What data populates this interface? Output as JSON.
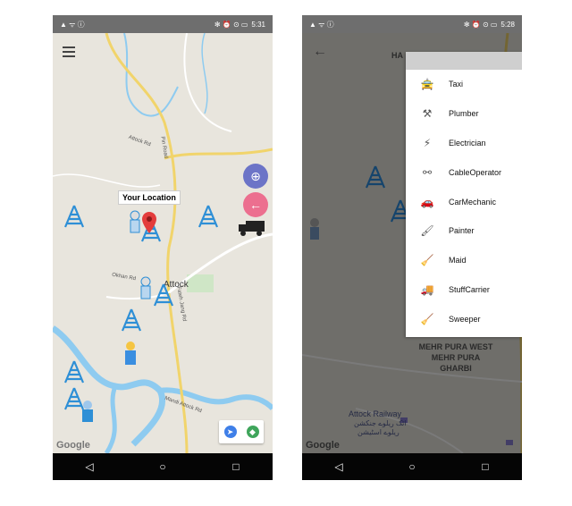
{
  "left_screen": {
    "status": {
      "left_icons": "▲ ᯤ ⓘ",
      "right_icons": "✻ ⏰ ⊙ ▭",
      "time": "5:31"
    },
    "your_location_label": "Your Location",
    "place_labels": {
      "town": "Attock"
    },
    "road_labels": [
      "Attock Rd",
      "Pin Road",
      "Fateh Jang Rd",
      "Mandi Attock Rd",
      "Okhan Rd"
    ],
    "google_label": "Google",
    "colors": {
      "locate_fab": "#6c74c7",
      "back_fab": "#ec6f8f",
      "pin": "#e33c3c",
      "tower": "#2e8fd6"
    }
  },
  "right_screen": {
    "status": {
      "left_icons": "▲ ᯤ ⓘ",
      "right_icons": "✻ ⏰ ⊙ ▭",
      "time": "5:28"
    },
    "place_labels": [
      "HA",
      "MEHR PURA WEST",
      "MEHR PURA",
      "GHARBI",
      "Attock Railway",
      "اٹک ریلوے جنکشن",
      "ریلوے اسٹیشن"
    ],
    "google_label": "Google",
    "menu_items": [
      {
        "label": "Taxi",
        "icon": "taxi-icon",
        "glyph": "🚖"
      },
      {
        "label": "Plumber",
        "icon": "plumber-icon",
        "glyph": "⚒"
      },
      {
        "label": "Electrician",
        "icon": "electrician-icon",
        "glyph": "⚡"
      },
      {
        "label": "CableOperator",
        "icon": "cable-operator-icon",
        "glyph": "⚯"
      },
      {
        "label": "CarMechanic",
        "icon": "car-mechanic-icon",
        "glyph": "🚗"
      },
      {
        "label": "Painter",
        "icon": "painter-icon",
        "glyph": "🖌"
      },
      {
        "label": "Maid",
        "icon": "maid-icon",
        "glyph": "🧹"
      },
      {
        "label": "StuffCarrier",
        "icon": "truck-icon",
        "glyph": "🚚"
      },
      {
        "label": "Sweeper",
        "icon": "sweeper-icon",
        "glyph": "🧹"
      }
    ]
  }
}
